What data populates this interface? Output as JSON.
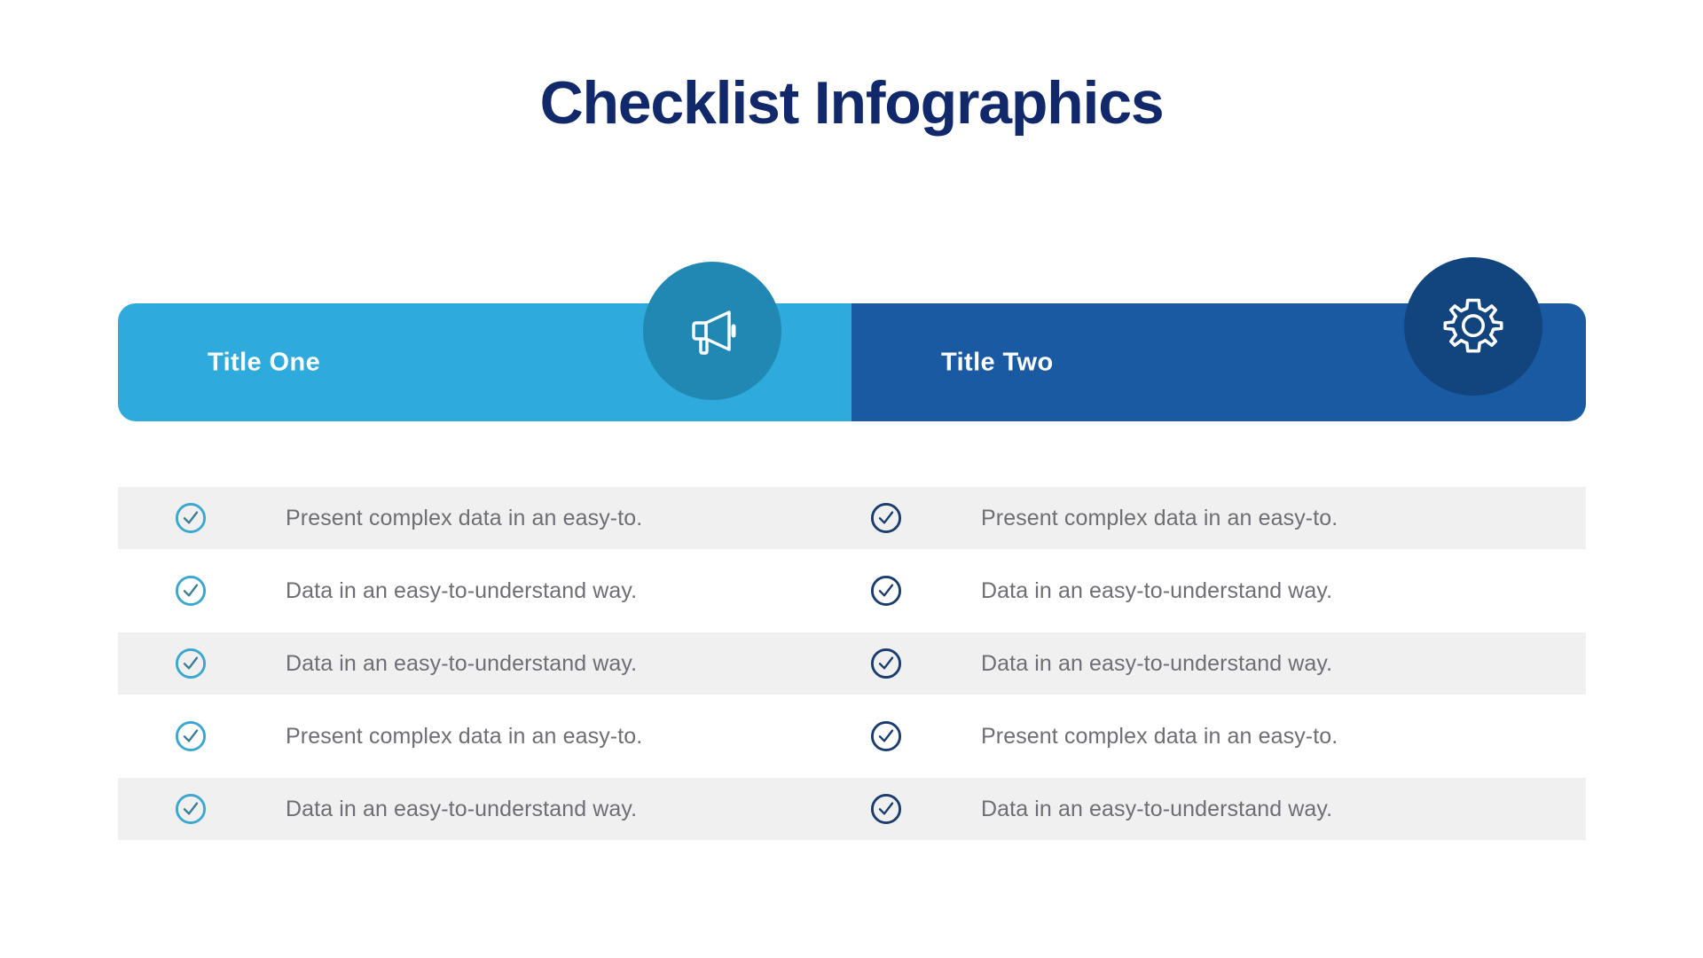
{
  "title": "Checklist Infographics",
  "colors": {
    "title_navy": "#11296B",
    "column_one_bar": "#2FAADC",
    "column_two_bar": "#1A5AA3",
    "badge_one": "#2188B4",
    "badge_two": "#12447E",
    "row_shaded": "#F0F0F0",
    "row_plain": "#FFFFFF",
    "item_text": "#6E6E73",
    "check_one": "#3BA7CE",
    "check_two": "#1A3C6E"
  },
  "columns": [
    {
      "title": "Title One",
      "icon": "megaphone-icon",
      "items": [
        "Present complex data in an easy-to.",
        "Data in an easy-to-understand way.",
        "Data in an easy-to-understand way.",
        "Present complex data in an easy-to.",
        "Data in an easy-to-understand way."
      ]
    },
    {
      "title": "Title Two",
      "icon": "gear-icon",
      "items": [
        "Present complex data in an easy-to.",
        "Data in an easy-to-understand way.",
        "Data in an easy-to-understand way.",
        "Present complex data in an easy-to.",
        "Data in an easy-to-understand way."
      ]
    }
  ]
}
